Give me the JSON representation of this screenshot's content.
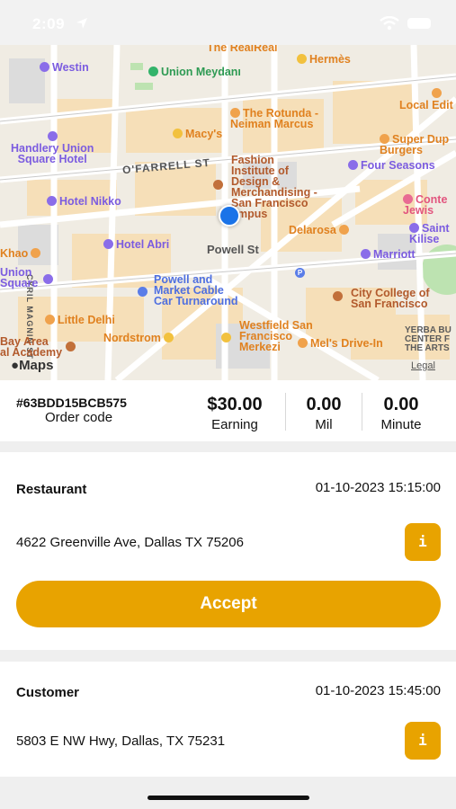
{
  "status_bar": {
    "time": "2:09"
  },
  "map": {
    "streets": [
      "O'FARRELL ST",
      "Powell St",
      "CYRIL MAGNIN ST"
    ],
    "pois": [
      {
        "label": "The RealReal",
        "color": "orange"
      },
      {
        "label": "Hermès",
        "color": "orange"
      },
      {
        "label": "Westin",
        "color": "purple"
      },
      {
        "label": "Union Meydanı",
        "color": "green"
      },
      {
        "label": "Local Edit",
        "color": "orange"
      },
      {
        "label": "The Rotunda -\nNeiman Marcus",
        "color": "orange"
      },
      {
        "label": "Handlery Union\nSquare Hotel",
        "color": "purple"
      },
      {
        "label": "Macy's",
        "color": "orange"
      },
      {
        "label": "Super Dup\nBurgers",
        "color": "orange"
      },
      {
        "label": "Fashion\nInstitute of\nDesign &\nMerchandising -\nSan Francisco\nampus",
        "color": "brown"
      },
      {
        "label": "Four Seasons",
        "color": "purple"
      },
      {
        "label": "Hotel Nikko",
        "color": "purple"
      },
      {
        "label": "Conte\nJewis",
        "color": "pink"
      },
      {
        "label": "Delarosa",
        "color": "orange"
      },
      {
        "label": "Saint\nKilise",
        "color": "purple"
      },
      {
        "label": "Khao",
        "color": "orange"
      },
      {
        "label": "Hotel Abri",
        "color": "purple"
      },
      {
        "label": "Marriott",
        "color": "purple"
      },
      {
        "label": "Union\nSquare",
        "color": "purple"
      },
      {
        "label": "Powell and\nMarket Cable\nCar Turnaround",
        "color": "blue"
      },
      {
        "label": "City College of\nSan Francisco",
        "color": "brown"
      },
      {
        "label": "Little Delhi",
        "color": "orange"
      },
      {
        "label": "Westfield San\nFrancisco\nMerkezi",
        "color": "orange"
      },
      {
        "label": "YERBA BU\nCENTER F\nTHE ARTS",
        "color": "gray"
      },
      {
        "label": "Nordstrom",
        "color": "orange"
      },
      {
        "label": "Bay Area\nal Academy",
        "color": "brown"
      },
      {
        "label": "Mel's Drive-In",
        "color": "orange"
      }
    ],
    "maps_label": "Maps",
    "legal_label": "Legal"
  },
  "summary": {
    "order_code": "#63BDD15BCB575",
    "order_code_label": "Order code",
    "earning_value": "$30.00",
    "earning_label": "Earning",
    "distance_value": "0.00",
    "distance_label": "Mil",
    "duration_value": "0.00",
    "duration_label": "Minute"
  },
  "restaurant": {
    "title": "Restaurant",
    "time": "01-10-2023 15:15:00",
    "address": "4622 Greenville Ave, Dallas TX 75206",
    "info_icon": "i"
  },
  "accept_label": "Accept",
  "customer": {
    "title": "Customer",
    "time": "01-10-2023 15:45:00",
    "address": "5803 E NW Hwy, Dallas, TX 75231",
    "info_icon": "i"
  },
  "icons": [
    "location-arrow-icon",
    "wifi-icon",
    "battery-icon",
    "apple-logo-icon",
    "user-location-icon",
    "info-icon"
  ],
  "colors": {
    "accent": "#e8a300",
    "user_location": "#1a73e8"
  }
}
